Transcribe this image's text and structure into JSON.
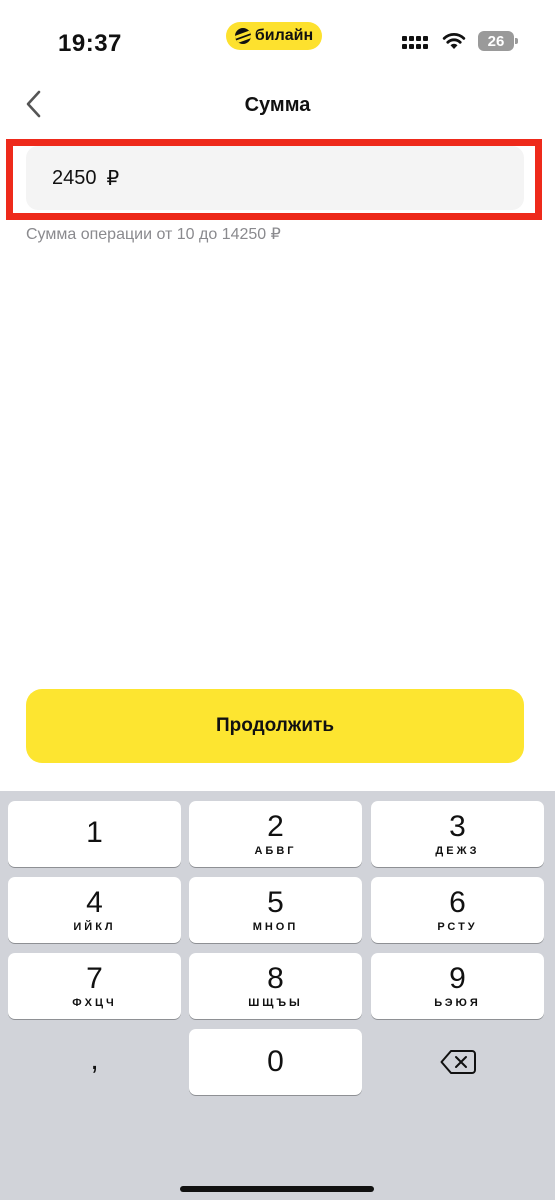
{
  "status_bar": {
    "time": "19:37",
    "carrier": "билайн",
    "battery": "26",
    "icons": [
      "signal-icon",
      "wifi-icon",
      "battery-icon"
    ]
  },
  "header": {
    "title": "Сумма",
    "back_icon": "chevron-left-icon"
  },
  "amount": {
    "value": "2450",
    "currency": "₽",
    "hint": "Сумма операции от 10 до 14250 ₽"
  },
  "actions": {
    "continue_label": "Продолжить"
  },
  "keypad": {
    "keys": [
      {
        "digit": "1",
        "letters": ""
      },
      {
        "digit": "2",
        "letters": "АБВГ"
      },
      {
        "digit": "3",
        "letters": "ДЕЖЗ"
      },
      {
        "digit": "4",
        "letters": "ИЙКЛ"
      },
      {
        "digit": "5",
        "letters": "МНОП"
      },
      {
        "digit": "6",
        "letters": "РСТУ"
      },
      {
        "digit": "7",
        "letters": "ФХЦЧ"
      },
      {
        "digit": "8",
        "letters": "ШЩЪЫ"
      },
      {
        "digit": "9",
        "letters": "ЬЭЮЯ"
      },
      {
        "digit": "0",
        "letters": ""
      }
    ],
    "comma": ",",
    "delete_icon": "backspace-icon"
  },
  "colors": {
    "accent_yellow": "#fde530",
    "highlight_red": "#ee2a1b",
    "keypad_bg": "#d1d3d9"
  }
}
